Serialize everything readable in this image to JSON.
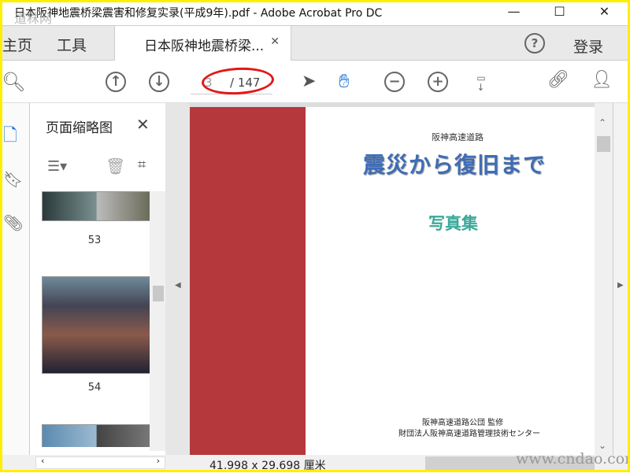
{
  "window": {
    "title": "日本阪神地震桥梁震害和修复实录(平成9年).pdf - Adobe Acrobat Pro DC",
    "watermark": "道秣网"
  },
  "tabs": {
    "home": "主页",
    "tools": "工具",
    "document": "日本阪神地震桥梁...",
    "login": "登录"
  },
  "toolbar": {
    "page_current": "3",
    "page_total": "/ 147"
  },
  "panel": {
    "title": "页面缩略图",
    "thumbnails": [
      {
        "label": "53"
      },
      {
        "label": "54"
      }
    ]
  },
  "document": {
    "publisher_line": "阪神高速道路",
    "title": "震災から復旧まで",
    "subtitle": "写真集",
    "credit1": "阪神高速道路公団 監修",
    "credit2": "財団法人阪神高速道路管理技術センター"
  },
  "status": {
    "size": "41.998 x 29.698 厘米",
    "watermark": "www.cndao.com"
  }
}
